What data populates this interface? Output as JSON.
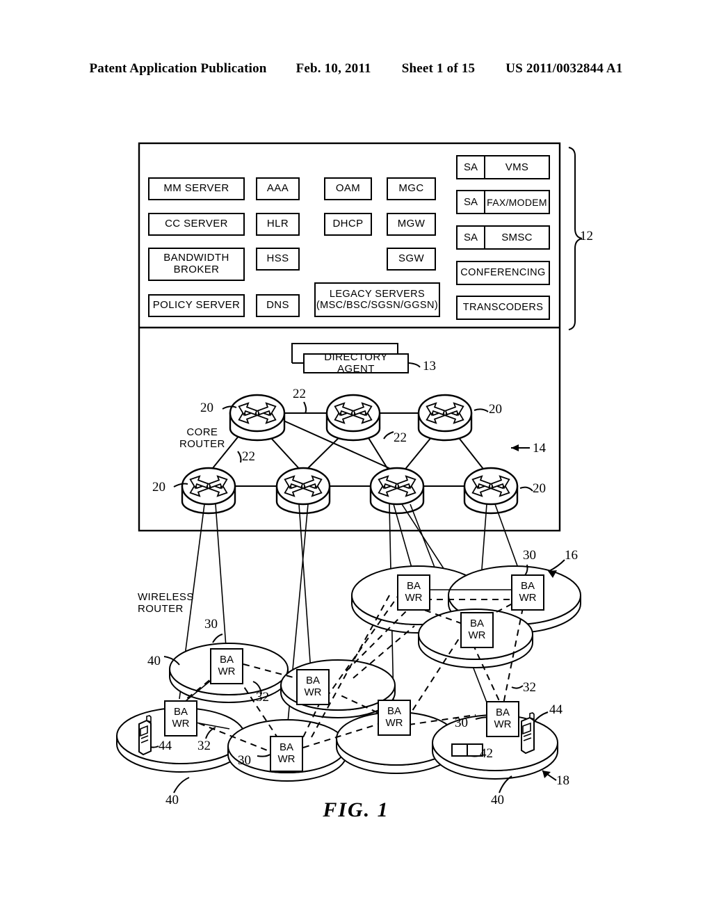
{
  "header": {
    "publication": "Patent Application Publication",
    "date": "Feb. 10, 2011",
    "sheet": "Sheet 1 of 15",
    "number": "US 2011/0032844 A1"
  },
  "figure": {
    "caption": "FIG.  1"
  },
  "core_network_box": {
    "reference": "12",
    "servers_col1": [
      {
        "label": "MM SERVER"
      },
      {
        "label": "CC SERVER"
      },
      {
        "label": "BANDWIDTH\nBROKER"
      },
      {
        "label": "POLICY SERVER"
      }
    ],
    "servers_col2": [
      {
        "label": "AAA"
      },
      {
        "label": "HLR"
      },
      {
        "label": "HSS"
      },
      {
        "label": "DNS"
      }
    ],
    "servers_col3": [
      {
        "label": "OAM"
      },
      {
        "label": "DHCP"
      }
    ],
    "servers_col4": [
      {
        "label": "MGC"
      },
      {
        "label": "MGW"
      },
      {
        "label": "SGW"
      }
    ],
    "legacy_servers": {
      "label": "LEGACY SERVERS\n(MSC/BSC/SGSN/GGSN)"
    },
    "sa_services": [
      {
        "prefix": "SA",
        "label": "VMS"
      },
      {
        "prefix": "SA",
        "label": "FAX/MODEM"
      },
      {
        "prefix": "SA",
        "label": "SMSC"
      }
    ],
    "services": [
      {
        "label": "CONFERENCING"
      },
      {
        "label": "TRANSCODERS"
      }
    ]
  },
  "transport": {
    "directory_agent": {
      "label": "DIRECTORY AGENT",
      "reference": "13"
    },
    "network_reference": "14",
    "core_router_label": "CORE\nROUTER",
    "router_reference": "20",
    "link_reference": "22",
    "router_refs": [
      "20",
      "20",
      "20",
      "20"
    ],
    "link_refs": [
      "22",
      "22",
      "22"
    ]
  },
  "access": {
    "wireless_router_label": "WIRELESS\nROUTER",
    "bawr_label_line1": "BA",
    "bawr_label_line2": "WR",
    "bawr_reference": "30",
    "wireless_link_reference": "32",
    "cell_reference": "40",
    "terminal_reference": "42",
    "handset_reference": "44",
    "upper_access_reference": "16",
    "lower_access_reference": "18",
    "bawr_refs": [
      "30",
      "30",
      "30",
      "30"
    ],
    "link_refs": [
      "32",
      "32",
      "32",
      "32"
    ],
    "cell_refs": [
      "40",
      "40",
      "40"
    ],
    "handset_refs": [
      "44",
      "44"
    ]
  },
  "colors": {
    "ink": "#000000",
    "paper": "#ffffff"
  }
}
